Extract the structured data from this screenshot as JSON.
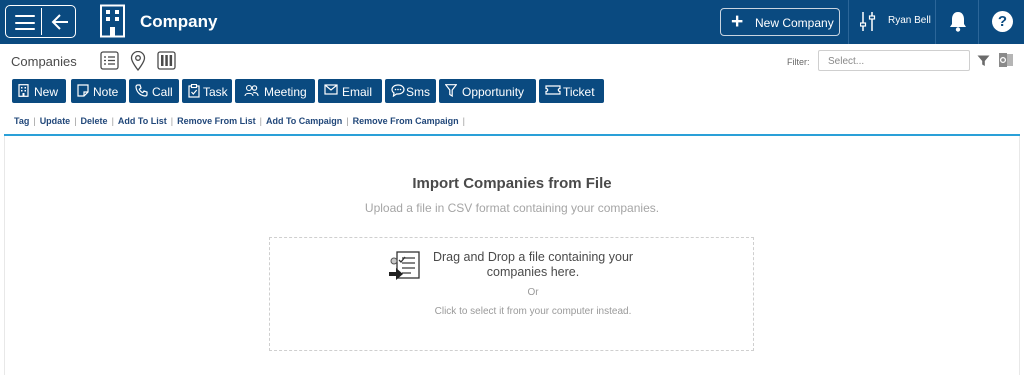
{
  "header": {
    "app_title": "Company",
    "new_button_label": "New Company",
    "user_name": "Ryan Bell",
    "help_glyph": "?",
    "icons": [
      "hamburger-icon",
      "back-arrow-icon",
      "building-icon",
      "plus-icon",
      "sliders-icon",
      "bell-icon",
      "help-icon"
    ]
  },
  "subheader": {
    "section_label": "Companies",
    "view_icons": [
      "list-view-icon",
      "map-view-icon",
      "kanban-view-icon"
    ],
    "filter_label": "Filter:",
    "filter_placeholder": "Select...",
    "right_icons": [
      "funnel-icon",
      "outlook-icon"
    ]
  },
  "toolbar": [
    {
      "label": "New",
      "icon": "building-icon"
    },
    {
      "label": "Note",
      "icon": "note-icon"
    },
    {
      "label": "Call",
      "icon": "phone-icon"
    },
    {
      "label": "Task",
      "icon": "task-icon"
    },
    {
      "label": "Meeting",
      "icon": "meeting-icon"
    },
    {
      "label": "Email",
      "icon": "email-icon"
    },
    {
      "label": "Sms",
      "icon": "sms-icon"
    },
    {
      "label": "Opportunity",
      "icon": "funnel-icon"
    },
    {
      "label": "Ticket",
      "icon": "ticket-icon"
    }
  ],
  "links": [
    "Tag",
    "Update",
    "Delete",
    "Add To List",
    "Remove From List",
    "Add To Campaign",
    "Remove From Campaign"
  ],
  "link_separator": "|",
  "import": {
    "title": "Import Companies from File",
    "subtitle": "Upload a file in CSV format containing your companies.",
    "drop_text": "Drag and Drop a file containing your companies here.",
    "or_text": "Or",
    "click_text": "Click to select it from your computer instead."
  },
  "colors": {
    "header_bg": "#0a4a80",
    "button_bg": "#0a4a80",
    "accent_rule": "#2aa0d8",
    "link_color": "#22487a"
  }
}
